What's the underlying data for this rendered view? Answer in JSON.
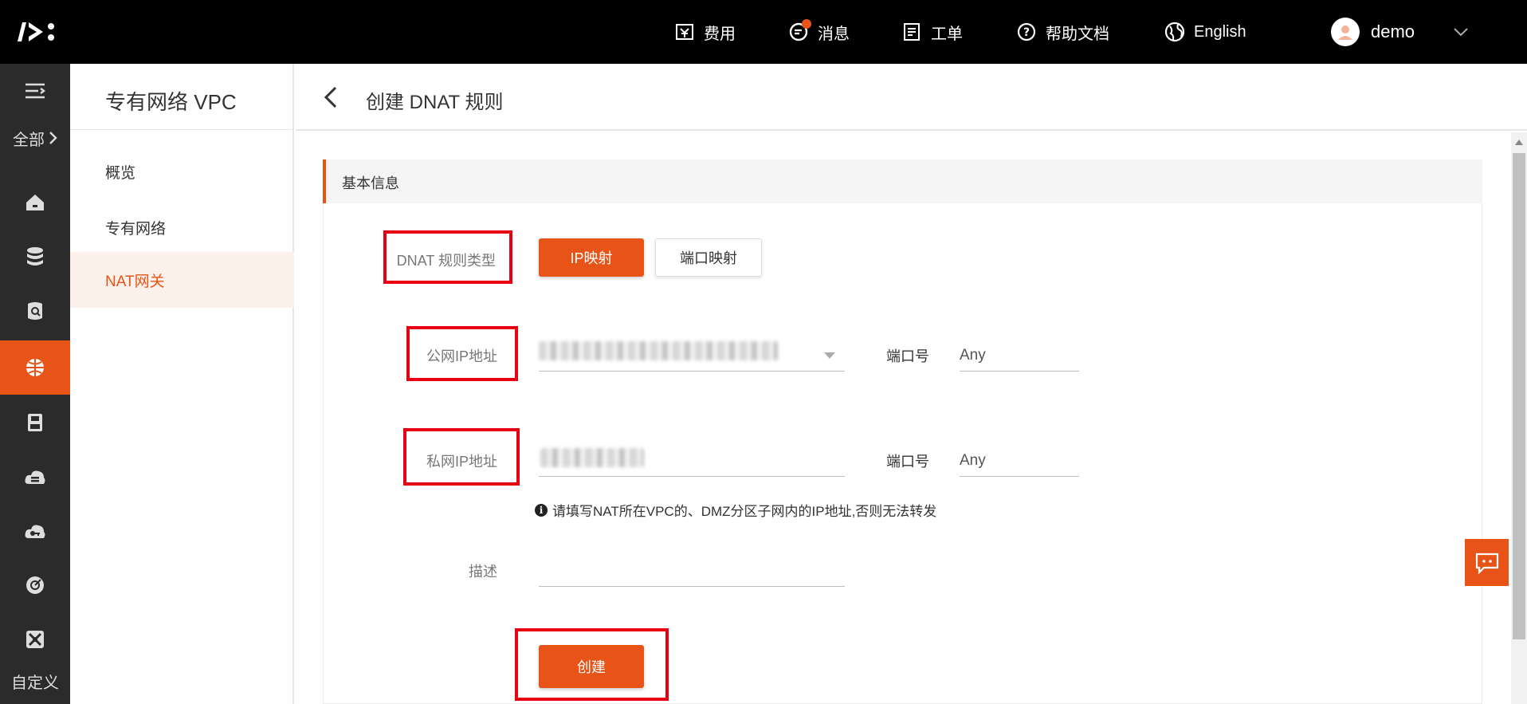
{
  "topbar": {
    "items": [
      {
        "label": "费用",
        "icon": "fee-icon"
      },
      {
        "label": "消息",
        "icon": "message-icon"
      },
      {
        "label": "工单",
        "icon": "ticket-icon"
      },
      {
        "label": "帮助文档",
        "icon": "help-icon"
      },
      {
        "label": "English",
        "icon": "globe-icon"
      }
    ],
    "user": "demo"
  },
  "rail": {
    "all_label": "全部",
    "custom_label": "自定义"
  },
  "sidebar": {
    "title": "专有网络 VPC",
    "items": [
      "概览",
      "专有网络",
      "NAT网关"
    ],
    "active_index": 2
  },
  "header": {
    "title": "创建 DNAT 规则"
  },
  "form": {
    "section_title": "基本信息",
    "rule_type_label": "DNAT 规则类型",
    "rule_type_options": [
      "IP映射",
      "端口映射"
    ],
    "rule_type_selected": "IP映射",
    "public_ip_label": "公网IP地址",
    "private_ip_label": "私网IP地址",
    "port_label": "端口号",
    "public_port_value": "Any",
    "private_port_value": "Any",
    "hint": "请填写NAT所在VPC的、DMZ分区子网内的IP地址,否则无法转发",
    "description_label": "描述",
    "description_value": "",
    "submit_label": "创建"
  },
  "colors": {
    "accent": "#e85417",
    "highlight_box": "#e60012",
    "topbar_bg": "#000000",
    "rail_bg": "#2b2b2b"
  }
}
